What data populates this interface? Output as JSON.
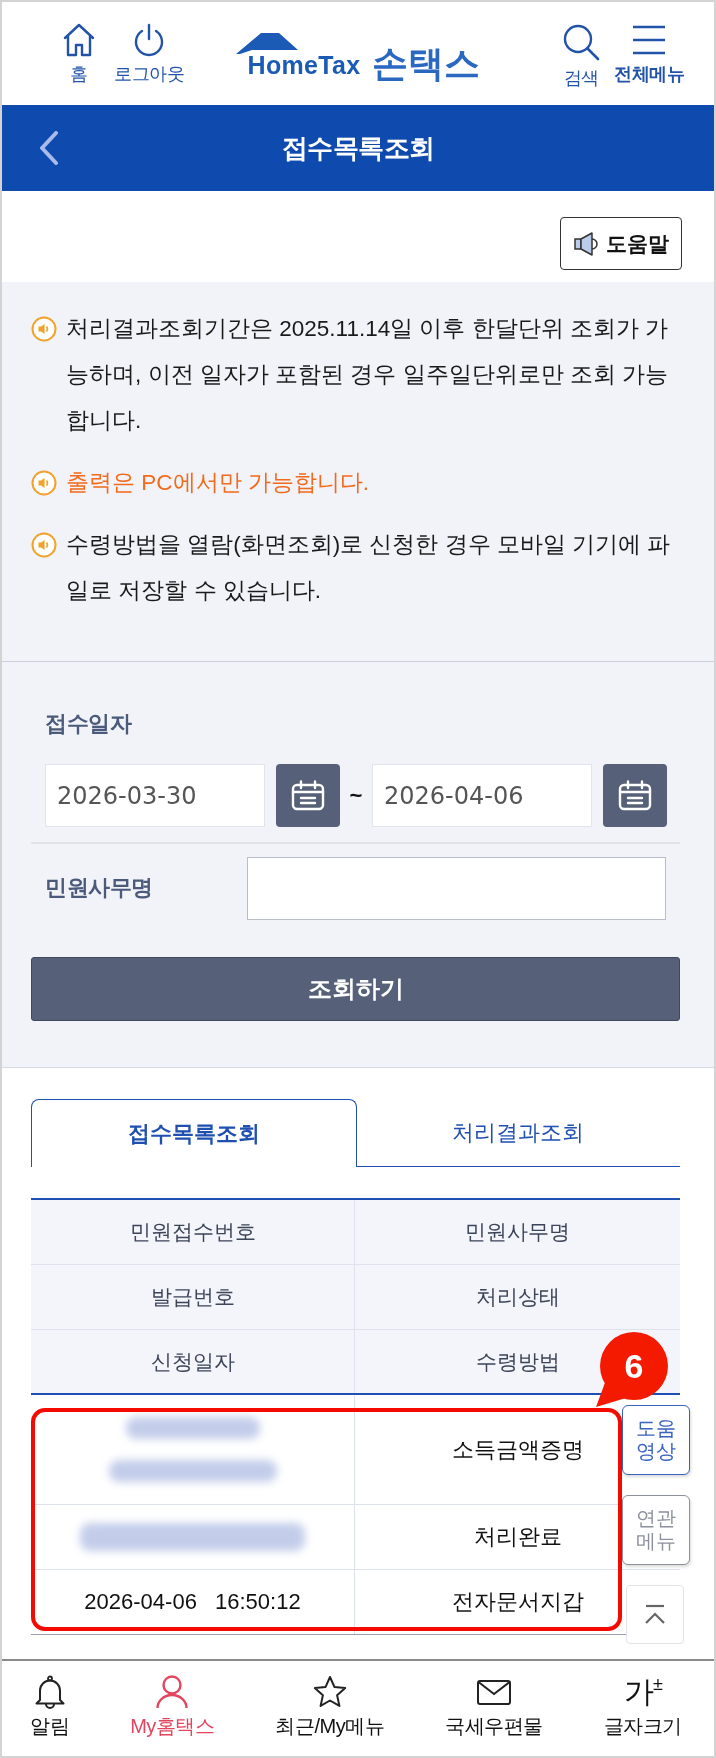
{
  "header": {
    "left_items": [
      {
        "label": "홈"
      },
      {
        "label": "로그아웃"
      }
    ],
    "logo": {
      "wordmark": "HomeTax",
      "name": "손택스"
    },
    "right_items": [
      {
        "label": "검색"
      },
      {
        "label": "전체메뉴"
      }
    ]
  },
  "title_bar": {
    "title": "접수목록조회"
  },
  "help_button": {
    "label": "도움말"
  },
  "notices": [
    {
      "text": "처리결과조회기간은 2025.11.14일 이후 한달단위 조회가 가능하며, 이전 일자가 포함된 경우 일주일단위로만 조회 가능합니다.",
      "highlight": false
    },
    {
      "text": "출력은 PC에서만 가능합니다.",
      "highlight": true
    },
    {
      "text": "수령방법을 열람(화면조회)로 신청한 경우 모바일 기기에 파일로 저장할 수 있습니다.",
      "highlight": false
    }
  ],
  "search_form": {
    "date_label": "접수일자",
    "date_from": "2026-03-30",
    "separator": "~",
    "date_to": "2026-04-06",
    "name_label": "민원사무명",
    "submit_button": "조회하기"
  },
  "tabs": [
    {
      "label": "접수목록조회",
      "selected": true
    },
    {
      "label": "처리결과조회",
      "selected": false
    }
  ],
  "table": {
    "header_rows": [
      [
        "민원접수번호",
        "민원사무명"
      ],
      [
        "발급번호",
        "처리상태"
      ],
      [
        "신청일자",
        "수령방법"
      ]
    ],
    "rows": [
      [
        {
          "kind": "blurred_pair"
        },
        {
          "kind": "text",
          "text": "소득금액증명"
        }
      ],
      [
        {
          "kind": "blurred"
        },
        {
          "kind": "text",
          "text": "처리완료"
        }
      ],
      [
        {
          "kind": "text",
          "text": "2026-04-06 16:50:12"
        },
        {
          "kind": "text",
          "text": "전자문서지갑"
        }
      ]
    ]
  },
  "annotation": {
    "number": "6"
  },
  "side_buttons": [
    {
      "label": "도움 영상",
      "color": "#3a62c0"
    },
    {
      "label": "연관 메뉴",
      "color": "#8c919c"
    }
  ],
  "bottom_nav": [
    {
      "label": "알림",
      "selected": false
    },
    {
      "label": "My홈택스",
      "selected": true
    },
    {
      "label": "최근/My메뉴",
      "selected": false
    },
    {
      "label": "국세우편물",
      "selected": false
    },
    {
      "label": "글자크기",
      "selected": false,
      "glyph": "가$^{±}$"
    }
  ]
}
